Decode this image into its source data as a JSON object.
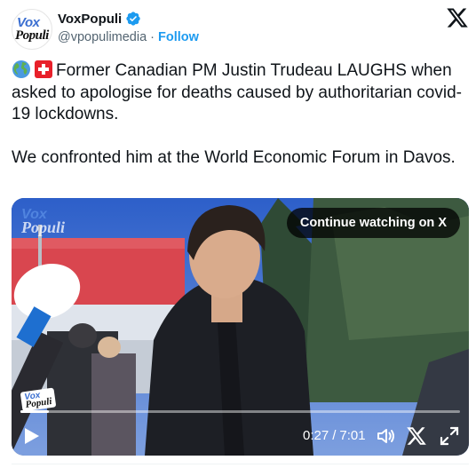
{
  "account": {
    "avatar_line1": "Vox",
    "avatar_line2": "Populi",
    "display_name": "VoxPopuli",
    "handle": "@vpopulimedia",
    "separator": "·",
    "follow_label": "Follow"
  },
  "tweet": {
    "paragraph1": "Former Canadian PM Justin Trudeau LAUGHS when asked to apologise for deaths caused by authoritarian covid-19 lockdowns.",
    "paragraph2": "We confronted him at the World Economic Forum in Davos.",
    "emojis": [
      "globe-europe-africa",
      "flag-switzerland"
    ]
  },
  "video": {
    "continue_label": "Continue watching on X",
    "current_time": "0:27",
    "time_separator": "/",
    "duration": "7:01",
    "progress_fraction": 0.064,
    "watermark_line1": "Vox",
    "watermark_line2": "Populi",
    "mic_flag_line1": "Vox",
    "mic_flag_line2": "Populi",
    "controls": [
      "play-icon",
      "volume-icon",
      "x-logo-icon",
      "fullscreen-icon"
    ]
  },
  "colors": {
    "accent": "#1d9bf0",
    "text": "#0f1419",
    "secondary_text": "#536471"
  }
}
